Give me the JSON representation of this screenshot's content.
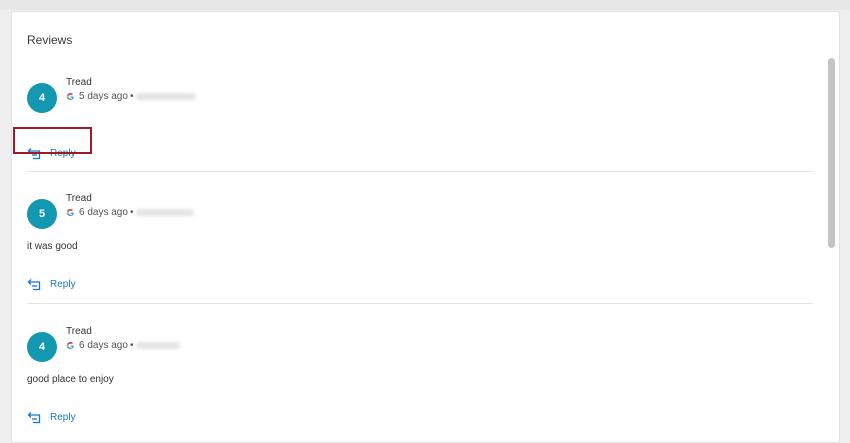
{
  "panel": {
    "title": "Reviews"
  },
  "colors": {
    "accent": "#1497b0",
    "link": "#1a78c2",
    "highlight": "#9e1b26"
  },
  "icons": {
    "source": "google-g-icon",
    "reply": "reply-icon"
  },
  "reviews": [
    {
      "rating": "4",
      "reviewer": "Tread",
      "time": "5 days ago",
      "separator": "•",
      "text": "",
      "reply_label": "Reply"
    },
    {
      "rating": "5",
      "reviewer": "Tread",
      "time": "6 days ago",
      "separator": "•",
      "text": "it was good",
      "reply_label": "Reply"
    },
    {
      "rating": "4",
      "reviewer": "Tread",
      "time": "6 days ago",
      "separator": "•",
      "text": "good place to enjoy",
      "reply_label": "Reply"
    }
  ]
}
